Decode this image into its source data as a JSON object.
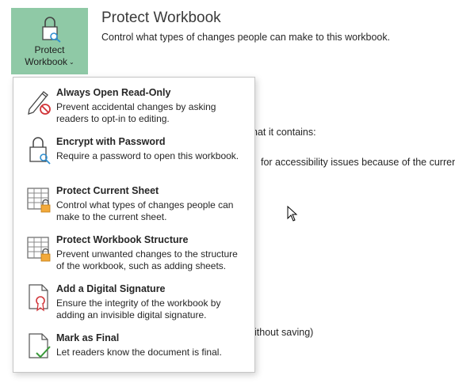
{
  "protect_button": {
    "line1": "Protect",
    "line2": "Workbook",
    "caret": "⌄"
  },
  "header": {
    "title": "Protect Workbook",
    "subtitle": "Control what types of changes people can make to this workbook."
  },
  "background_fragments": {
    "contains": "hat it contains:",
    "accessibility": "for accessibility issues because of the current",
    "saving": "ithout saving)"
  },
  "menu": {
    "items": [
      {
        "title": "Always Open Read-Only",
        "desc": "Prevent accidental changes by asking readers to opt-in to editing.",
        "icon": "pencil-no-icon"
      },
      {
        "title": "Encrypt with Password",
        "desc": "Require a password to open this workbook.",
        "icon": "lock-key-icon"
      },
      {
        "title": "Protect Current Sheet",
        "desc": "Control what types of changes people can make to the current sheet.",
        "icon": "sheet-lock-icon"
      },
      {
        "title": "Protect Workbook Structure",
        "desc": "Prevent unwanted changes to the structure of the workbook, such as adding sheets.",
        "icon": "workbook-lock-icon"
      },
      {
        "title": "Add a Digital Signature",
        "desc": "Ensure the integrity of the workbook by adding an invisible digital signature.",
        "icon": "ribbon-signature-icon"
      },
      {
        "title": "Mark as Final",
        "desc": "Let readers know the document is final.",
        "icon": "document-check-icon"
      }
    ]
  },
  "colors": {
    "button_bg": "#8fc9a6",
    "accent_orange": "#f2a93b",
    "no_red": "#d13438",
    "check_green": "#3a9a3a"
  }
}
